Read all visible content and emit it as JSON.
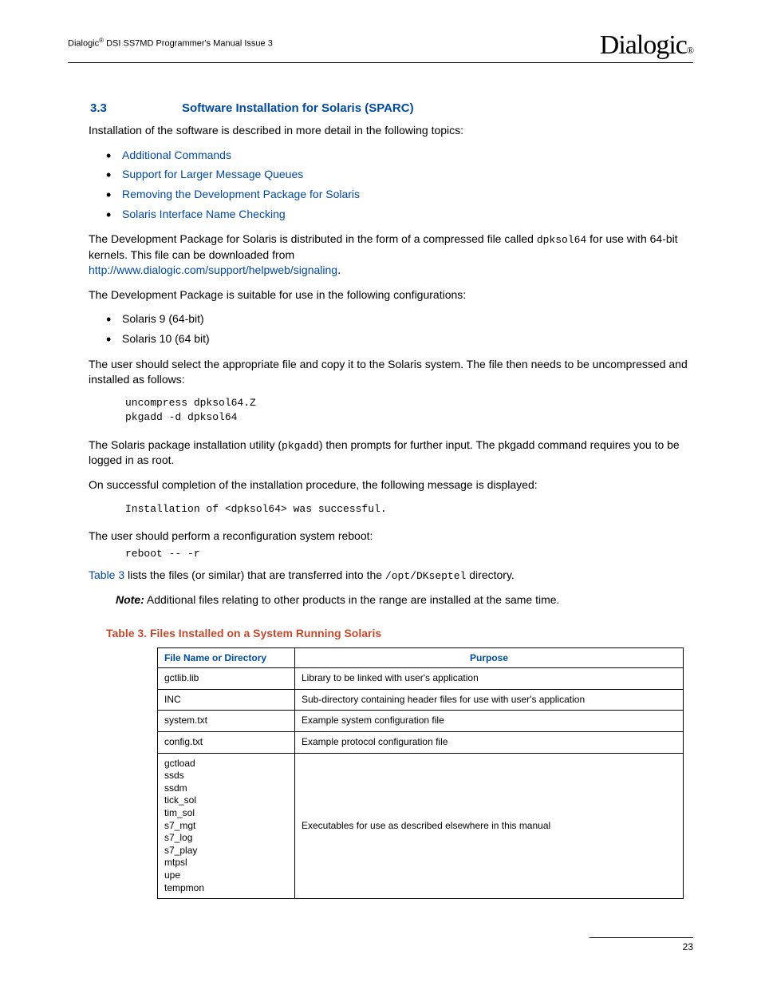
{
  "header": {
    "doc_title_prefix": "Dialogic",
    "doc_title_rest": " DSI SS7MD Programmer's Manual  Issue 3",
    "logo_text": "Dialogic",
    "logo_reg": "®"
  },
  "section": {
    "number": "3.3",
    "title": "Software Installation for Solaris (SPARC)"
  },
  "intro": "Installation of the software is described in more detail in the following topics:",
  "topic_links": [
    "Additional Commands",
    "Support for Larger Message Queues",
    "Removing the Development Package for Solaris",
    "Solaris Interface Name Checking"
  ],
  "para1_a": "The Development Package for Solaris is distributed in the form of a compressed file called ",
  "para1_mono": "dpksol64",
  "para1_b": " for use with 64-bit kernels. This file can be downloaded from ",
  "para1_link": "http://www.dialogic.com/support/helpweb/signaling",
  "para1_c": ".",
  "para2": "The Development Package is suitable for use in the following configurations:",
  "configs": [
    "Solaris 9 (64-bit)",
    "Solaris 10 (64 bit)"
  ],
  "para3": "The user should select the appropriate file and copy it to the Solaris system. The file then needs to be uncompressed and installed as follows:",
  "code1": "uncompress dpksol64.Z\npkgadd -d dpksol64",
  "para4_a": "The Solaris package installation utility (",
  "para4_mono": "pkgadd",
  "para4_b": ") then prompts for further input. The pkgadd command requires you to be logged in as root.",
  "para5": "On successful completion of the installation procedure, the following message is displayed:",
  "code2": "Installation of <dpksol64> was successful.",
  "para6": "The user should perform a reconfiguration system reboot:",
  "code3": "reboot -- -r",
  "para7_link": "Table 3",
  "para7_a": " lists the files (or similar) that are transferred into the ",
  "para7_mono": "/opt/DKseptel",
  "para7_b": " directory.",
  "note_label": "Note:",
  "note_text": "  Additional files relating to other products in the range are installed at the same time.",
  "table": {
    "caption": "Table 3.  Files Installed on a System Running Solaris",
    "headers": [
      "File Name or Directory",
      "Purpose"
    ],
    "rows": [
      {
        "name": "gctlib.lib",
        "purpose": "Library to be linked with user's application"
      },
      {
        "name": "INC",
        "purpose": "Sub-directory containing header files for use with user's application"
      },
      {
        "name": "system.txt",
        "purpose": "Example system configuration file"
      },
      {
        "name": "config.txt",
        "purpose": "Example protocol configuration file"
      },
      {
        "name": "gctload\nssds\nssdm\ntick_sol\ntim_sol\ns7_mgt\ns7_log\ns7_play\nmtpsl\nupe\ntempmon",
        "purpose": "Executables for use as described elsewhere in this manual"
      }
    ]
  },
  "page_number": "23"
}
